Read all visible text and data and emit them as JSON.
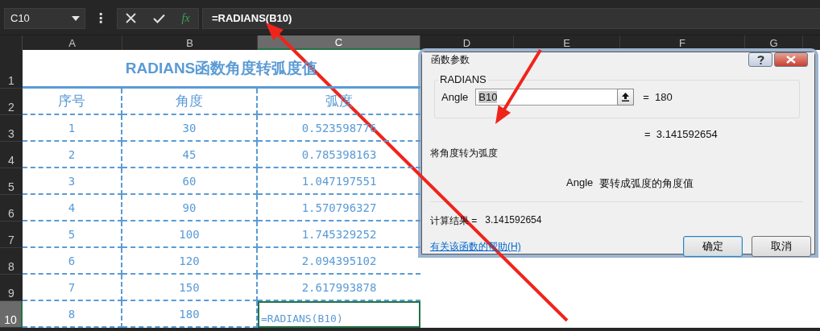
{
  "name_box": {
    "value": "C10"
  },
  "formula_bar": {
    "more": "⋮",
    "function_symbol": "fx",
    "formula": "=RADIANS(B10)"
  },
  "column_headers": [
    {
      "label": "A",
      "selected": false
    },
    {
      "label": "B",
      "selected": false
    },
    {
      "label": "C",
      "selected": true
    },
    {
      "label": "D",
      "selected": false
    },
    {
      "label": "E",
      "selected": false
    },
    {
      "label": "F",
      "selected": false
    },
    {
      "label": "G",
      "selected": false
    }
  ],
  "row_headers": [
    {
      "label": "1",
      "selected": false
    },
    {
      "label": "2",
      "selected": false
    },
    {
      "label": "3",
      "selected": false
    },
    {
      "label": "4",
      "selected": false
    },
    {
      "label": "5",
      "selected": false
    },
    {
      "label": "6",
      "selected": false
    },
    {
      "label": "7",
      "selected": false
    },
    {
      "label": "8",
      "selected": false
    },
    {
      "label": "9",
      "selected": false
    },
    {
      "label": "10",
      "selected": true
    }
  ],
  "sheet": {
    "title": "RADIANS函数角度转弧度值",
    "header": [
      "序号",
      "角度",
      "弧度"
    ],
    "rows": [
      {
        "cells": [
          "1",
          "30",
          "0.523598776"
        ],
        "active": false
      },
      {
        "cells": [
          "2",
          "45",
          "0.785398163"
        ],
        "active": false
      },
      {
        "cells": [
          "3",
          "60",
          "1.047197551"
        ],
        "active": false
      },
      {
        "cells": [
          "4",
          "90",
          "1.570796327"
        ],
        "active": false
      },
      {
        "cells": [
          "5",
          "100",
          "1.745329252"
        ],
        "active": false
      },
      {
        "cells": [
          "6",
          "120",
          "2.094395102"
        ],
        "active": false
      },
      {
        "cells": [
          "7",
          "150",
          "2.617993878"
        ],
        "active": false
      },
      {
        "cells": [
          "8",
          "180",
          "=RADIANS(B10)"
        ],
        "active": true
      }
    ]
  },
  "dialog": {
    "title": "函数参数",
    "function_name": "RADIANS",
    "argument": {
      "label": "Angle",
      "value": "B10",
      "value_selected": true,
      "result": "=  180"
    },
    "formula_result": "=  3.141592654",
    "description": "将角度转为弧度",
    "argument_help": {
      "label": "Angle",
      "text": "要转成弧度的角度值"
    },
    "result": {
      "label": "计算结果 =",
      "value": "3.141592654"
    },
    "help_link": "有关该函数的帮助(H)",
    "buttons": [
      {
        "label": "确定",
        "default": true
      },
      {
        "label": "取消",
        "default": false
      }
    ]
  }
}
